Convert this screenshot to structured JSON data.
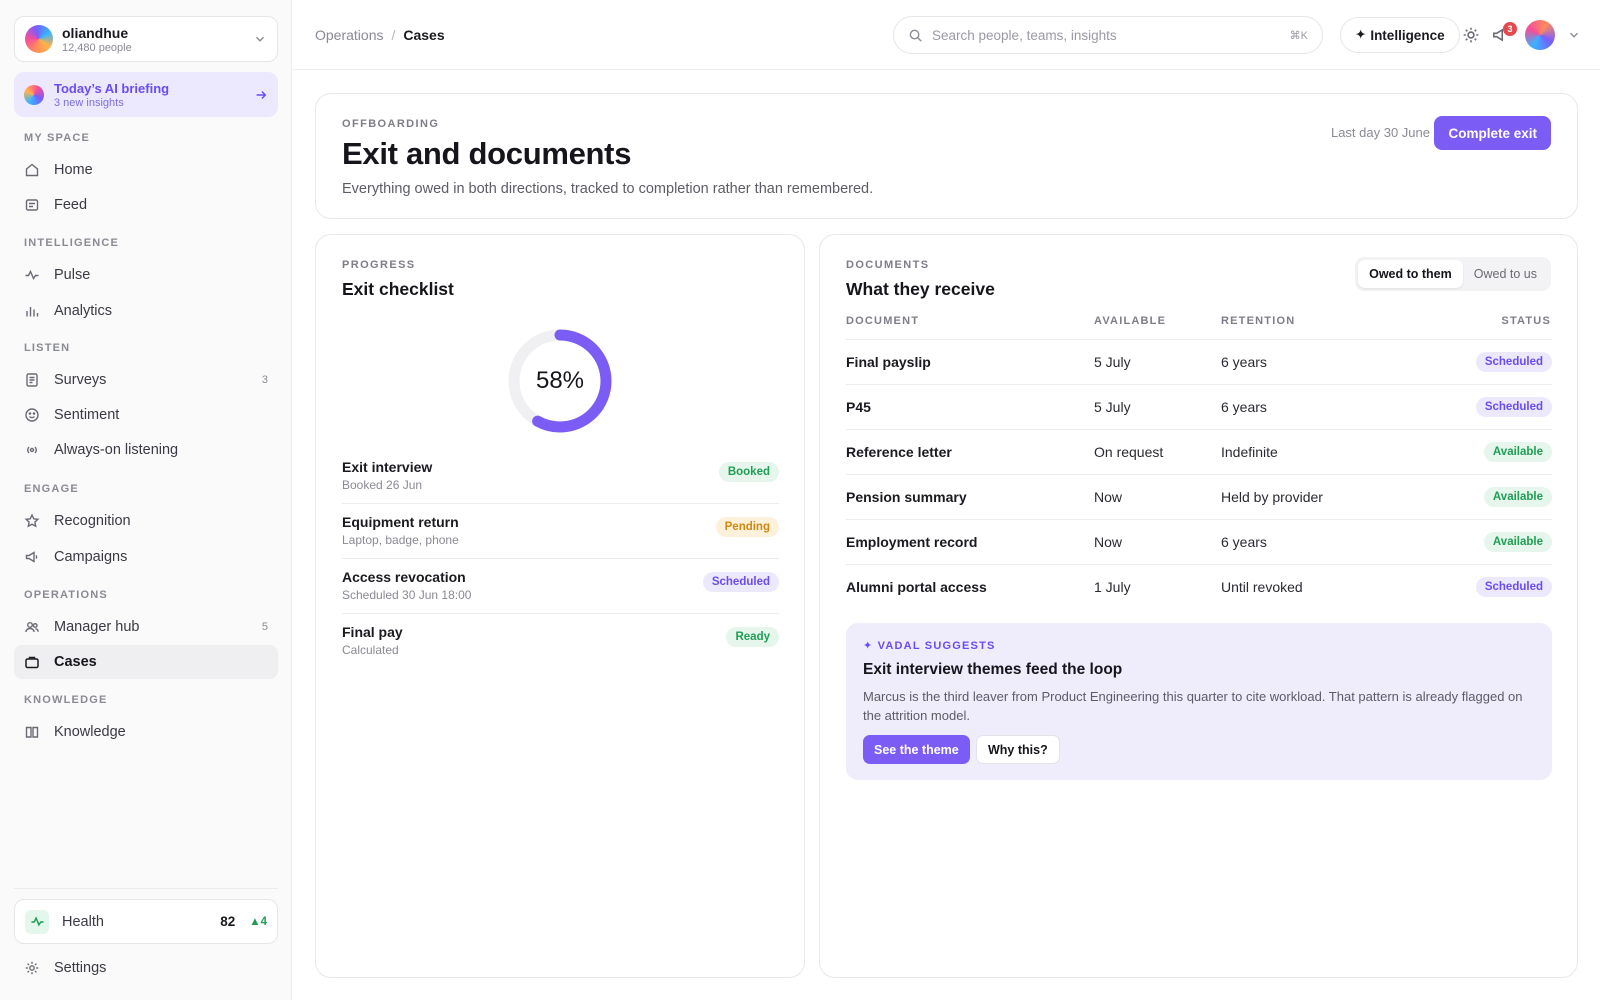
{
  "org": {
    "name": "oliandhue",
    "people": "12,480 people"
  },
  "briefing": {
    "title": "Today’s AI briefing",
    "subtitle": "3 new insights"
  },
  "nav": {
    "sections": [
      "MY SPACE",
      "INTELLIGENCE",
      "LISTEN",
      "ENGAGE",
      "OPERATIONS",
      "KNOWLEDGE"
    ],
    "items": [
      {
        "label": "Home",
        "icon": "home-icon"
      },
      {
        "label": "Feed",
        "icon": "feed-icon"
      },
      {
        "label": "Pulse",
        "icon": "pulse-icon"
      },
      {
        "label": "Analytics",
        "icon": "bar-chart-icon"
      },
      {
        "label": "Surveys",
        "icon": "survey-icon",
        "count": "3"
      },
      {
        "label": "Sentiment",
        "icon": "smile-icon"
      },
      {
        "label": "Always-on listening",
        "icon": "broadcast-icon"
      },
      {
        "label": "Recognition",
        "icon": "star-icon"
      },
      {
        "label": "Campaigns",
        "icon": "megaphone-icon"
      },
      {
        "label": "Manager hub",
        "icon": "users-icon",
        "count": "5"
      },
      {
        "label": "Cases",
        "icon": "briefcase-icon",
        "active": true
      },
      {
        "label": "Knowledge",
        "icon": "book-icon"
      }
    ],
    "health": {
      "label": "Health",
      "score": "82",
      "delta": "▲4"
    },
    "settings": "Settings"
  },
  "topbar": {
    "breadcrumb": {
      "parent": "Operations",
      "sep": "/",
      "current": "Cases"
    },
    "search_placeholder": "Search people, teams, insights",
    "search_shortcut": "⌘K",
    "intelligence_label": "Intelligence",
    "notification_count": "3"
  },
  "header": {
    "eyebrow": "OFFBOARDING",
    "title": "Exit and documents",
    "description": "Everything owed in both directions, tracked to completion rather than remembered.",
    "last_day": "Last day 30 June",
    "complete_label": "Complete exit"
  },
  "checklist": {
    "eyebrow": "PROGRESS",
    "title": "Exit checklist",
    "progress": 58,
    "progress_label": "58%",
    "items": [
      {
        "title": "Exit interview",
        "sub": "Booked 26 Jun",
        "status": "Booked",
        "tone": "green"
      },
      {
        "title": "Equipment return",
        "sub": "Laptop, badge, phone",
        "status": "Pending",
        "tone": "amber"
      },
      {
        "title": "Access revocation",
        "sub": "Scheduled 30 Jun 18:00",
        "status": "Scheduled",
        "tone": "purple"
      },
      {
        "title": "Final pay",
        "sub": "Calculated",
        "status": "Ready",
        "tone": "green"
      }
    ]
  },
  "documents": {
    "eyebrow": "DOCUMENTS",
    "title": "What they receive",
    "toggle": [
      "Owed to them",
      "Owed to us"
    ],
    "columns": [
      "DOCUMENT",
      "AVAILABLE",
      "RETENTION",
      "STATUS"
    ],
    "rows": [
      {
        "doc": "Final payslip",
        "available": "5 July",
        "retention": "6 years",
        "status": "Scheduled",
        "tone": "purple"
      },
      {
        "doc": "P45",
        "available": "5 July",
        "retention": "6 years",
        "status": "Scheduled",
        "tone": "purple"
      },
      {
        "doc": "Reference letter",
        "available": "On request",
        "retention": "Indefinite",
        "status": "Available",
        "tone": "green"
      },
      {
        "doc": "Pension summary",
        "available": "Now",
        "retention": "Held by provider",
        "status": "Available",
        "tone": "green"
      },
      {
        "doc": "Employment record",
        "available": "Now",
        "retention": "6 years",
        "status": "Available",
        "tone": "green"
      },
      {
        "doc": "Alumni portal access",
        "available": "1 July",
        "retention": "Until revoked",
        "status": "Scheduled",
        "tone": "purple"
      }
    ],
    "suggestion": {
      "eyebrow": "✦ VADAL SUGGESTS",
      "title": "Exit interview themes feed the loop",
      "body": "Marcus is the third leaver from Product Engineering this quarter to cite workload. That pattern is already flagged on the attrition model.",
      "primary": "See the theme",
      "secondary": "Why this?"
    }
  },
  "colors": {
    "accent": "#7b5cf5",
    "success": "#1f9d55",
    "warning": "#d08a12",
    "danger": "#e5484d"
  }
}
